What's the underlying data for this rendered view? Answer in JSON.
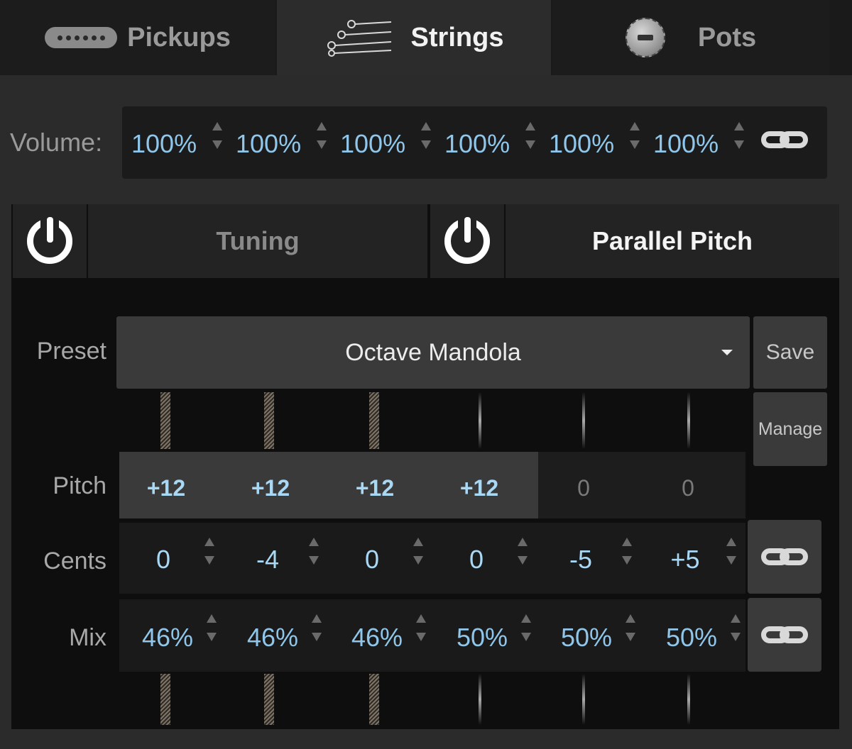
{
  "tabs": {
    "pickups": "Pickups",
    "strings": "Strings",
    "pots": "Pots"
  },
  "volume": {
    "label": "Volume:",
    "values": [
      "100%",
      "100%",
      "100%",
      "100%",
      "100%",
      "100%"
    ]
  },
  "features": {
    "tuning": "Tuning",
    "parallel_pitch": "Parallel Pitch"
  },
  "preset": {
    "label": "Preset",
    "value": "Octave Mandola",
    "save": "Save",
    "manage": "Manage"
  },
  "pitch": {
    "label": "Pitch",
    "values": [
      "+12",
      "+12",
      "+12",
      "+12",
      "0",
      "0"
    ]
  },
  "cents": {
    "label": "Cents",
    "values": [
      "0",
      "-4",
      "0",
      "0",
      "-5",
      "+5"
    ]
  },
  "mix": {
    "label": "Mix",
    "values": [
      "46%",
      "46%",
      "46%",
      "50%",
      "50%",
      "50%"
    ]
  },
  "colors": {
    "value_blue": "#8fc6ea",
    "pitch_blue": "#a9d8f5",
    "panel": "#2b2b2b",
    "dark": "#0e0e0e"
  },
  "icons": [
    "pickup-icon",
    "strings-icon",
    "pot-icon",
    "link-icon",
    "power-icon",
    "dropdown-caret-icon",
    "stepper-up-icon",
    "stepper-down-icon"
  ]
}
